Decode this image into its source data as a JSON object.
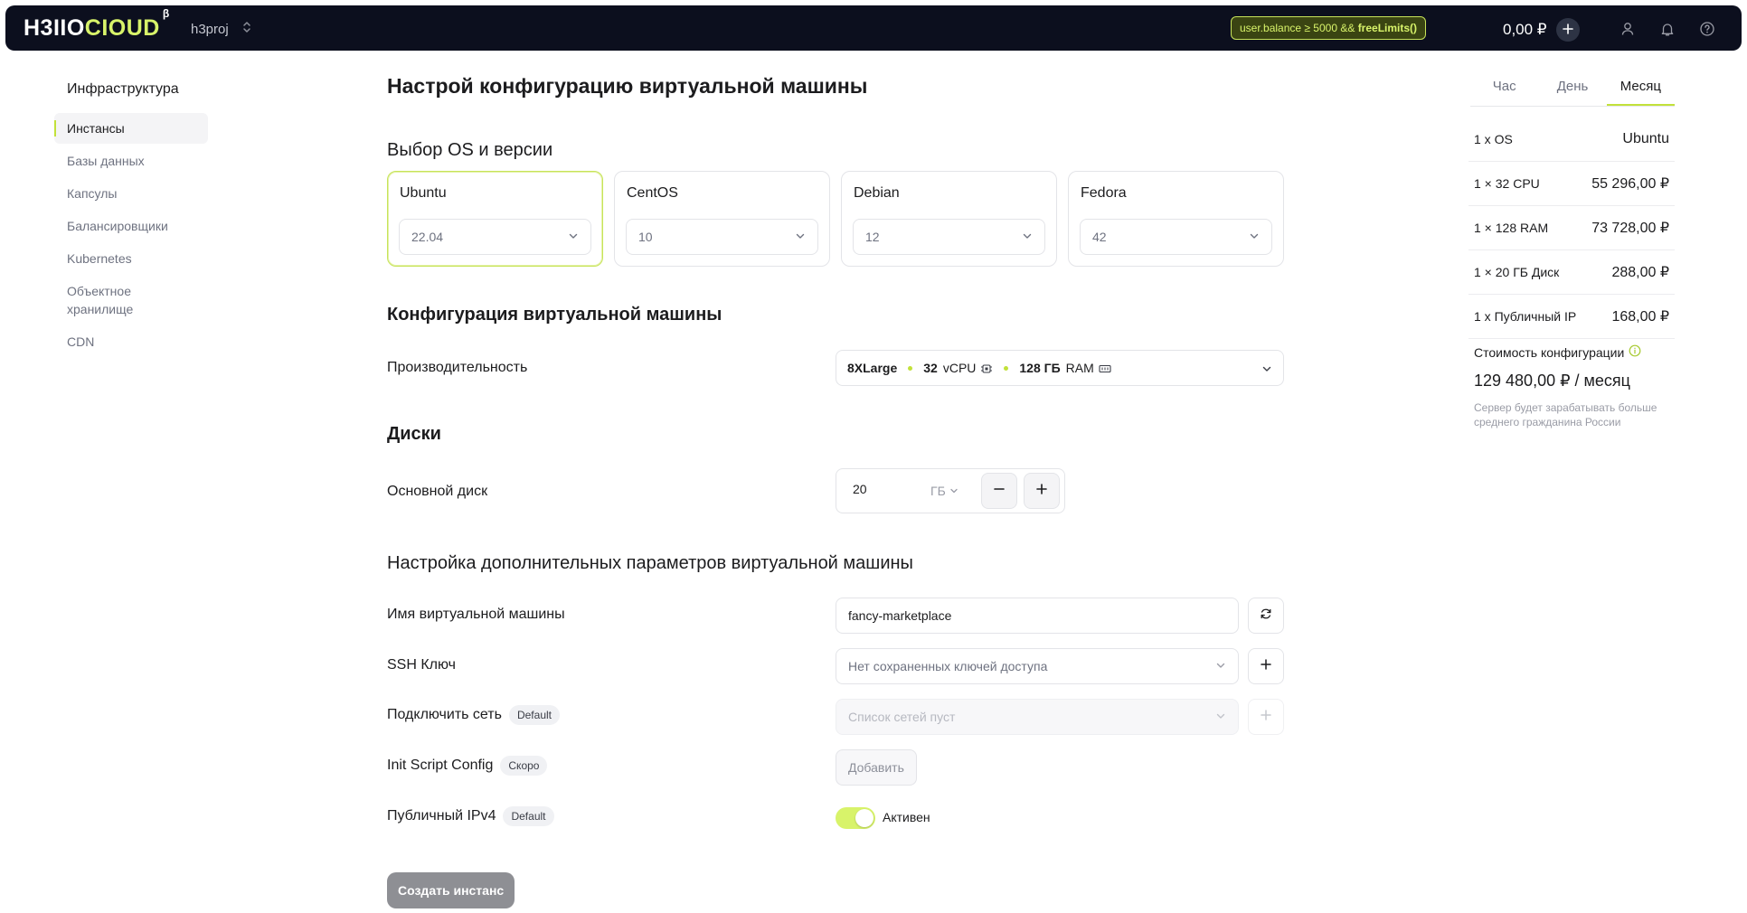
{
  "topbar": {
    "logo_part1": "H3IIO",
    "logo_part2": "CIOUD",
    "logo_beta": "β",
    "project": "h3proj",
    "promo_code": "user.balance ≥ 5000 &&",
    "promo_func": "freeLimits()",
    "balance": "0,00 ₽",
    "icons": [
      "plus-icon",
      "user-icon",
      "bell-icon",
      "help-icon"
    ]
  },
  "sidebar": {
    "title": "Инфраструктура",
    "items": [
      {
        "label": "Инстансы"
      },
      {
        "label": "Базы данных"
      },
      {
        "label": "Капсулы"
      },
      {
        "label": "Балансировщики"
      },
      {
        "label": "Kubernetes"
      },
      {
        "label": "Объектное хранилище"
      },
      {
        "label": "CDN"
      }
    ]
  },
  "main": {
    "title": "Настрой конфигурацию виртуальной машины",
    "os_section": "Выбор OS и версии",
    "os_cards": [
      {
        "name": "Ubuntu",
        "version": "22.04"
      },
      {
        "name": "CentOS",
        "version": "10"
      },
      {
        "name": "Debian",
        "version": "12"
      },
      {
        "name": "Fedora",
        "version": "42"
      }
    ],
    "config_section": "Конфигурация виртуальной машины",
    "perf_label": "Производительность",
    "perf": {
      "size": "8XLarge",
      "cpu_value": "32",
      "cpu_unit": "vCPU",
      "ram_value": "128 ГБ",
      "ram_unit": "RAM"
    },
    "disks_section": "Диски",
    "disk_label": "Основной диск",
    "disk_value": "20",
    "disk_unit": "ГБ",
    "advanced_section": "Настройка дополнительных параметров виртуальной машины",
    "vm_name_label": "Имя виртуальной машины",
    "vm_name_value": "fancy-marketplace",
    "ssh_label": "SSH Ключ",
    "ssh_placeholder": "Нет сохраненных ключей доступа",
    "network_label": "Подключить сеть",
    "network_chip": "Default",
    "network_placeholder": "Список сетей пуст",
    "init_label": "Init Script Config",
    "init_chip": "Скоро",
    "init_button": "Добавить",
    "ipv4_label": "Публичный IPv4",
    "ipv4_chip": "Default",
    "ipv4_status": "Активен",
    "create_button": "Создать инстанс"
  },
  "summary": {
    "tabs": [
      {
        "label": "Час"
      },
      {
        "label": "День"
      },
      {
        "label": "Месяц"
      }
    ],
    "rows": [
      {
        "key": "1 x OS",
        "value": "Ubuntu"
      },
      {
        "key": "1 × 32 CPU",
        "value": "55 296,00 ₽"
      },
      {
        "key": "1 × 128 RAM",
        "value": "73 728,00 ₽"
      },
      {
        "key": "1 × 20 ГБ Диск",
        "value": "288,00 ₽"
      },
      {
        "key": "1 x Публичный IP",
        "value": "168,00 ₽"
      }
    ],
    "cost_label": "Стоимость конфигурации",
    "cost_value": "129 480,00  ₽ / месяц",
    "cost_note": "Сервер будет зарабатывать больше среднего гражданина России"
  },
  "colors": {
    "accent": "#c2e13a",
    "topbar_bg": "#0c0f1e",
    "create_button_bg": "#8e8f94"
  }
}
